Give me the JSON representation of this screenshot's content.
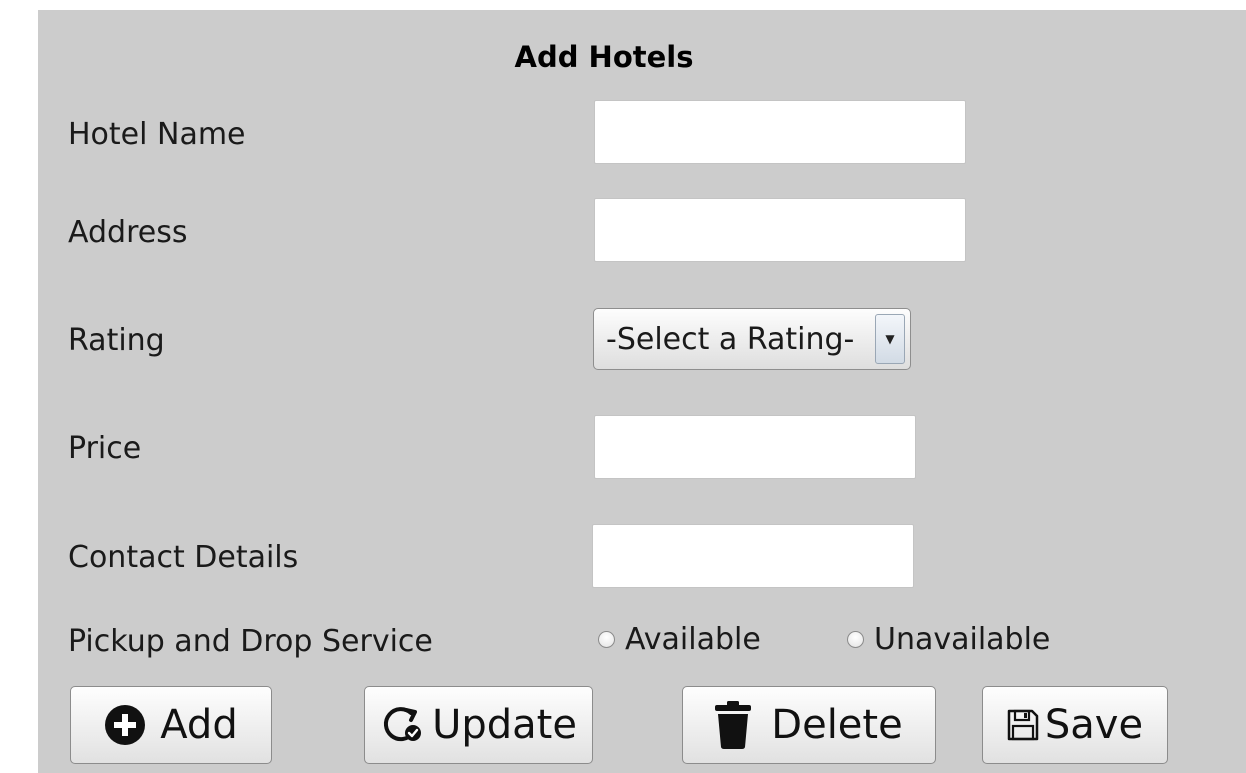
{
  "form": {
    "title": "Add Hotels",
    "fields": {
      "hotel_name": {
        "label": "Hotel Name",
        "value": ""
      },
      "address": {
        "label": "Address",
        "value": ""
      },
      "rating": {
        "label": "Rating",
        "selected": "-Select a Rating-"
      },
      "price": {
        "label": "Price",
        "value": ""
      },
      "contact_details": {
        "label": "Contact Details",
        "value": ""
      }
    },
    "pickup": {
      "label": "Pickup and Drop Service",
      "options": [
        "Available",
        "Unavailable"
      ],
      "selected": null
    }
  },
  "buttons": {
    "add": {
      "label": "Add",
      "icon": "plus-circle-icon"
    },
    "update": {
      "label": "Update",
      "icon": "refresh-check-icon"
    },
    "delete": {
      "label": "Delete",
      "icon": "trash-icon"
    },
    "save": {
      "label": "Save",
      "icon": "floppy-disk-icon"
    }
  }
}
